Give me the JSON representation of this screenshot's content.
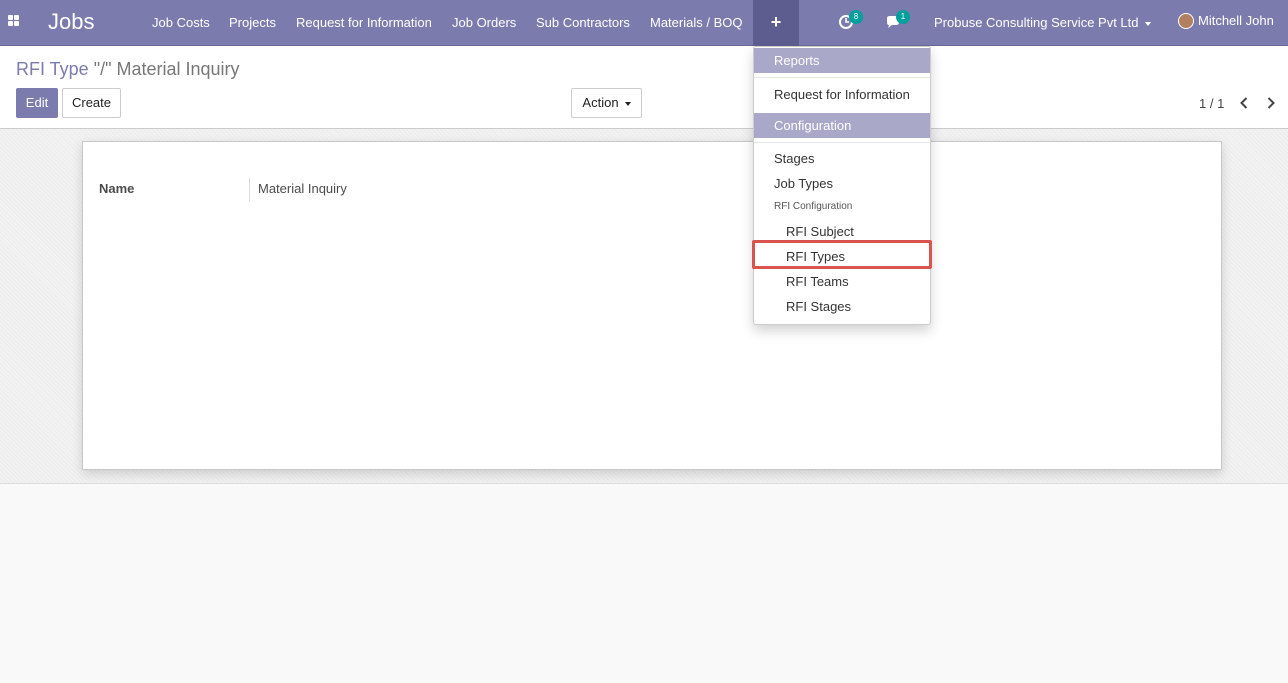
{
  "navbar": {
    "app_title": "Jobs",
    "menu": [
      "Job Costs",
      "Projects",
      "Request for Information",
      "Job Orders",
      "Sub Contractors",
      "Materials / BOQ"
    ],
    "plus_label": "+",
    "activity_count": "8",
    "message_count": "1",
    "company": "Probuse Consulting Service Pvt Ltd",
    "user": "Mitchell John"
  },
  "breadcrumb": {
    "parent": "RFI Type",
    "separator": " \"/\" ",
    "current": "Material Inquiry"
  },
  "toolbar": {
    "edit_label": "Edit",
    "create_label": "Create",
    "action_label": "Action"
  },
  "pager": {
    "value": "1 / 1"
  },
  "form": {
    "name_label": "Name",
    "name_value": "Material Inquiry"
  },
  "dropdown": {
    "reports_header": "Reports",
    "request_item": "Request for Information",
    "config_header": "Configuration",
    "stages_item": "Stages",
    "job_types_item": "Job Types",
    "rfi_config_label": "RFI Configuration",
    "rfi_subject_item": "RFI Subject",
    "rfi_types_item": "RFI Types",
    "rfi_teams_item": "RFI Teams",
    "rfi_stages_item": "RFI Stages"
  },
  "colors": {
    "brand": "#7c7bad",
    "badge": "#00a09d",
    "highlight": "#d9534f"
  },
  "icons": [
    "apps-grid-icon",
    "activity-clock-icon",
    "chat-bubble-icon",
    "chevron-left-icon",
    "chevron-right-icon"
  ]
}
